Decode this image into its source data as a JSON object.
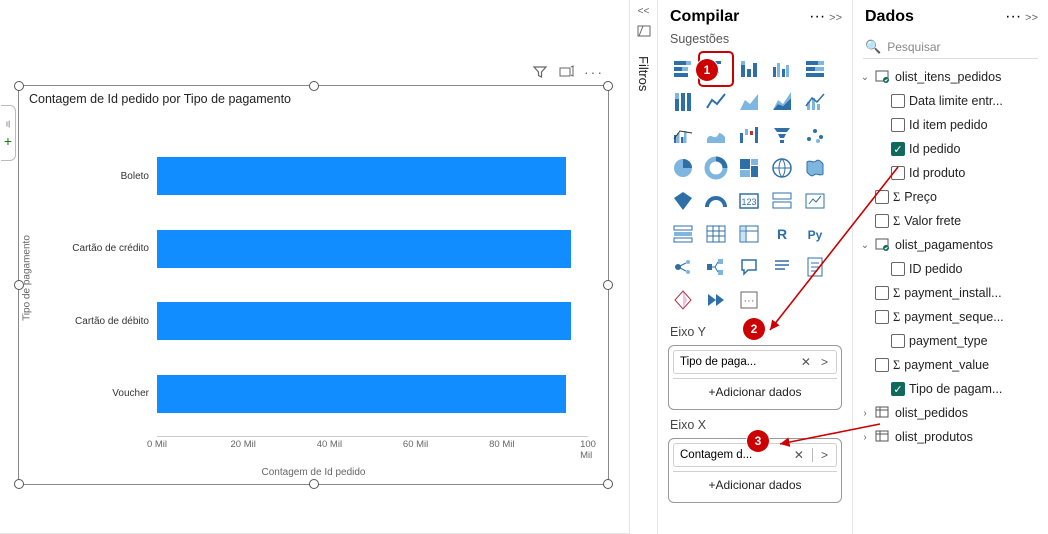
{
  "filters_pane": {
    "label": "Filtros"
  },
  "compile_pane": {
    "title": "Compilar",
    "suggestions": "Sugestões"
  },
  "data_pane": {
    "title": "Dados",
    "search_placeholder": "Pesquisar"
  },
  "chart_data": {
    "type": "bar",
    "orientation": "horizontal",
    "title": "Contagem de Id pedido por Tipo de pagamento",
    "xlabel": "Contagem de Id pedido",
    "ylabel": "Tipo de pagamento",
    "xlim": [
      0,
      100000
    ],
    "ticks": [
      "0 Mil",
      "20 Mil",
      "40 Mil",
      "60 Mil",
      "80 Mil",
      "100 Mil"
    ],
    "categories": [
      "Boleto",
      "Cartão de crédito",
      "Cartão de débito",
      "Voucher"
    ],
    "values": [
      95000,
      96000,
      96000,
      95000
    ]
  },
  "axis_y": {
    "label": "Eixo Y",
    "field": "Tipo de paga...",
    "add": "Adicionar dados"
  },
  "axis_x": {
    "label": "Eixo X",
    "field": "Contagem d...",
    "add": "Adicionar dados"
  },
  "callouts": {
    "one": "1",
    "two": "2",
    "three": "3"
  },
  "tree": {
    "t1": {
      "name": "olist_itens_pedidos",
      "fields": {
        "f1": "Data limite entr...",
        "f2": "Id item pedido",
        "f3": "Id pedido",
        "f4": "Id produto",
        "f5": "Preço",
        "f6": "Valor frete"
      }
    },
    "t2": {
      "name": "olist_pagamentos",
      "fields": {
        "f1": "ID pedido",
        "f2": "payment_install...",
        "f3": "payment_seque...",
        "f4": "payment_type",
        "f5": "payment_value",
        "f6": "Tipo de pagam..."
      }
    },
    "t3": {
      "name": "olist_pedidos"
    },
    "t4": {
      "name": "olist_produtos"
    }
  }
}
